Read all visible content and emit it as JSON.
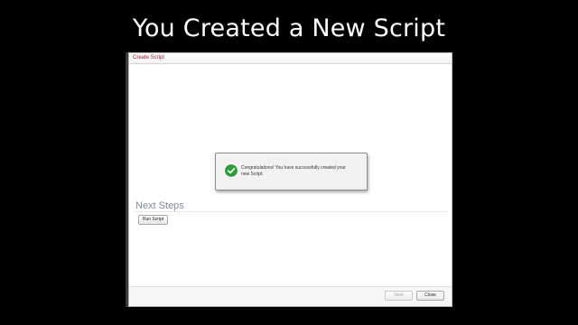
{
  "slide": {
    "title": "You Created a New Script"
  },
  "window": {
    "title": "Create Script",
    "title_color": "#9b1c2c"
  },
  "message": {
    "icon": "check-circle-icon",
    "icon_color": "#2e9e3a",
    "line1": "Congratulations! You have successfully created your",
    "line2": "new Script."
  },
  "next_steps": {
    "heading": "Next Steps",
    "run_script_label": "Run Script"
  },
  "footer": {
    "next_label": "Next",
    "close_label": "Close"
  }
}
